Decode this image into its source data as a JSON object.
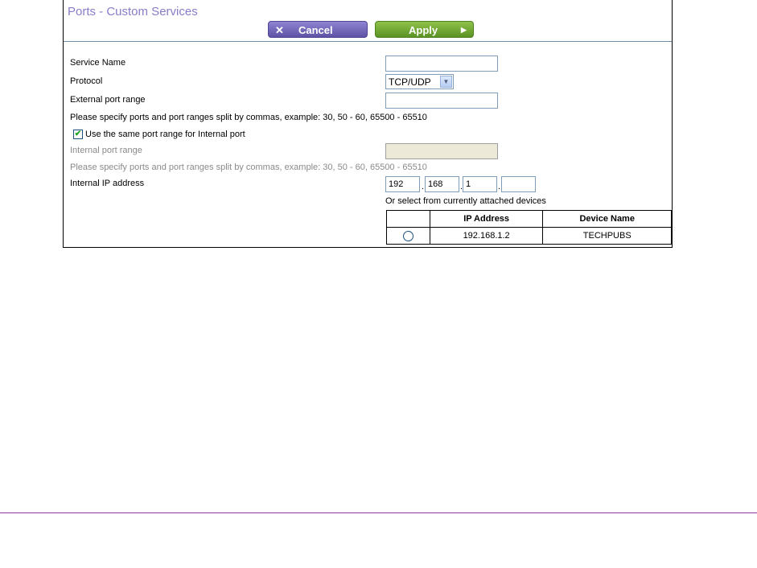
{
  "header": {
    "title": "Ports - Custom Services",
    "cancel_label": "Cancel",
    "cancel_icon": "x-icon",
    "apply_label": "Apply",
    "apply_icon": "arrow-right-icon"
  },
  "form": {
    "service_name_label": "Service Name",
    "service_name_value": "",
    "protocol_label": "Protocol",
    "protocol_value": "TCP/UDP",
    "external_port_label": "External port range",
    "external_port_value": "",
    "hint": "Please specify ports and port ranges split by commas, example: 30, 50 - 60, 65500 - 65510",
    "same_range_label": "Use the same port range for Internal port",
    "same_range_checked": true,
    "internal_port_label": "Internal port range",
    "internal_port_value": "",
    "internal_hint": "Please specify ports and port ranges split by commas, example: 30, 50 - 60, 65500 - 65510",
    "internal_ip_label": "Internal IP address",
    "ip_octets": [
      "192",
      "168",
      "1",
      ""
    ],
    "devices_caption": "Or select from currently attached devices"
  },
  "devices_table": {
    "headers": [
      "",
      "IP Address",
      "Device Name"
    ],
    "rows": [
      {
        "ip": "192.168.1.2",
        "name": "TECHPUBS"
      }
    ]
  },
  "colors": {
    "title": "#8a7cc9",
    "cancel_button": "#6a5fb5",
    "apply_button": "#6ea336",
    "footer_line": "#8a3b9e"
  }
}
